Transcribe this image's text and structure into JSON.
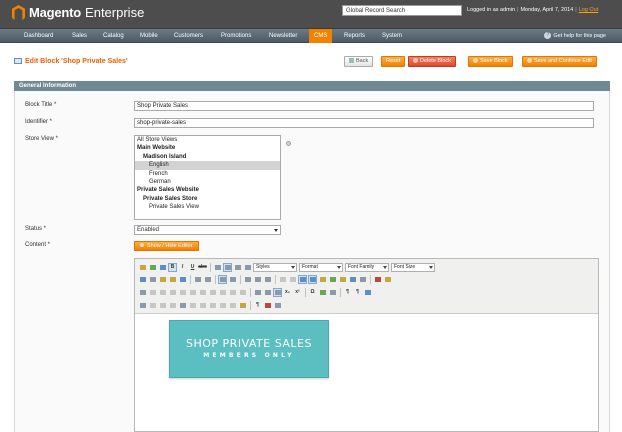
{
  "header": {
    "brand": "Magento",
    "edition": "Enterprise",
    "search_value": "Global Record Search",
    "logged_in": "Logged in as admin",
    "date": "Monday, April 7, 2014",
    "logout": "Log Out"
  },
  "nav": {
    "items": [
      "Dashboard",
      "Sales",
      "Catalog",
      "Mobile",
      "Customers",
      "Promotions",
      "Newsletter",
      "CMS",
      "Reports",
      "System"
    ],
    "active": "CMS",
    "help": "Get help for this page"
  },
  "page": {
    "title": "Edit Block 'Shop Private Sales'",
    "buttons": {
      "back": "Back",
      "reset": "Reset",
      "delete": "Delete Block",
      "save": "Save Block",
      "save_continue": "Save and Continue Edit"
    }
  },
  "section": {
    "title": "General Information"
  },
  "form": {
    "block_title_label": "Block Title *",
    "block_title_value": "Shop Private Sales",
    "identifier_label": "Identifier *",
    "identifier_value": "shop-private-sales",
    "store_view_label": "Store View *",
    "store_views": [
      {
        "label": "All Store Views",
        "style": "normal",
        "indent": 0,
        "selected": false
      },
      {
        "label": "Main Website",
        "style": "bold",
        "indent": 0,
        "selected": false
      },
      {
        "label": "Madison Island",
        "style": "bold",
        "indent": 1,
        "selected": false
      },
      {
        "label": "English",
        "style": "normal",
        "indent": 2,
        "selected": true
      },
      {
        "label": "French",
        "style": "normal",
        "indent": 2,
        "selected": false
      },
      {
        "label": "German",
        "style": "normal",
        "indent": 2,
        "selected": false
      },
      {
        "label": "Private Sales Website",
        "style": "bold",
        "indent": 0,
        "selected": false
      },
      {
        "label": "Private Sales Store",
        "style": "bold",
        "indent": 1,
        "selected": false
      },
      {
        "label": "Private Sales View",
        "style": "normal",
        "indent": 2,
        "selected": false
      }
    ],
    "status_label": "Status *",
    "status_value": "Enabled",
    "content_label": "Content *",
    "show_hide_editor": "Show / Hide Editor"
  },
  "editor": {
    "styles": "Styles",
    "format": "Format",
    "font_family": "Font Family",
    "font_size": "Font Size",
    "banner_line1": "SHOP PRIVATE SALES",
    "banner_line2": "MEMBERS ONLY"
  },
  "colors": {
    "accent": "#f18200",
    "title": "#eb5e00",
    "section_bar": "#6f8992",
    "banner": "#5bbec0"
  }
}
